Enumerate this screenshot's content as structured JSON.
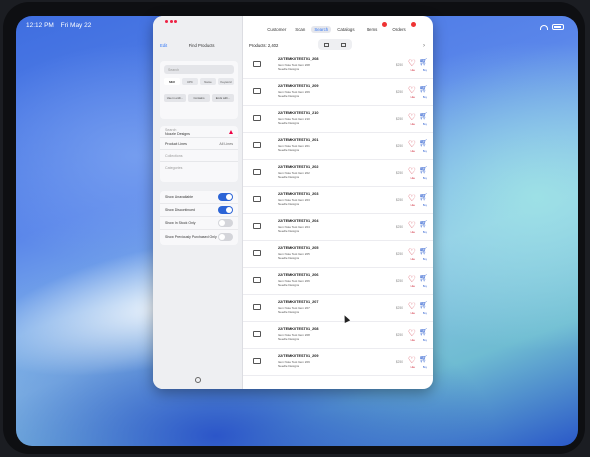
{
  "status_bar": {
    "time": "12:12 PM",
    "date": "Fri May 22"
  },
  "sidebar": {
    "edit_label": "Edit",
    "title": "Find Products",
    "search_placeholder": "Search",
    "segments": [
      "SKU",
      "UPC",
      "Name",
      "Keyword"
    ],
    "chips": [
      "Use in enth...",
      "Contains",
      "Ends with..."
    ],
    "filters": [
      {
        "label": "Search",
        "value": "Nozzle Designs"
      },
      {
        "label": "Product Lines",
        "value": "All Lines"
      },
      {
        "label": "Collections",
        "value": ""
      },
      {
        "label": "Categories",
        "value": ""
      }
    ],
    "toggles": [
      {
        "label": "Show Unavailable",
        "on": true
      },
      {
        "label": "Show Discontinued",
        "on": true
      },
      {
        "label": "Show In Stock Only",
        "on": false
      },
      {
        "label": "Show Previously Purchased Only",
        "on": false
      }
    ]
  },
  "tabs": [
    {
      "label": "Customer",
      "badge": false
    },
    {
      "label": "Scan",
      "badge": false
    },
    {
      "label": "Search",
      "badge": false,
      "active": true
    },
    {
      "label": "Catalogs",
      "badge": false
    },
    {
      "label": "Items",
      "badge": true
    },
    {
      "label": "Orders",
      "badge": true
    }
  ],
  "toolbar": {
    "products_count": "Products: 2,402"
  },
  "products": [
    {
      "sku": "22/TEMK0TEST01_208",
      "name": "Item Note Test Item 208",
      "brand": "Needle Designs",
      "price": "$250"
    },
    {
      "sku": "22/TEMK0TEST01_209",
      "name": "Item Note Test Item 209",
      "brand": "Needle Designs",
      "price": "$250"
    },
    {
      "sku": "22/TEMK0TEST01_210",
      "name": "Item Note Test Item 210",
      "brand": "Needle Designs",
      "price": "$250"
    },
    {
      "sku": "22/TEMK0TEST01_201",
      "name": "Item Note Test Item 201",
      "brand": "Needle Designs",
      "price": "$250"
    },
    {
      "sku": "22/TEMK0TEST01_202",
      "name": "Item Note Test Item 202",
      "brand": "Needle Designs",
      "price": "$250"
    },
    {
      "sku": "22/TEMK0TEST01_203",
      "name": "Item Note Test Item 203",
      "brand": "Needle Designs",
      "price": "$250"
    },
    {
      "sku": "22/TEMK0TEST01_204",
      "name": "Item Note Test Item 204",
      "brand": "Needle Designs",
      "price": "$250"
    },
    {
      "sku": "22/TEMK0TEST01_205",
      "name": "Item Note Test Item 205",
      "brand": "Needle Designs",
      "price": "$250"
    },
    {
      "sku": "22/TEMK0TEST01_206",
      "name": "Item Note Test Item 206",
      "brand": "Needle Designs",
      "price": "$250"
    },
    {
      "sku": "22/TEMK0TEST01_207",
      "name": "Item Note Test Item 207",
      "brand": "Needle Designs",
      "price": "$250"
    },
    {
      "sku": "22/TEMK0TEST01_208",
      "name": "Item Note Test Item 208",
      "brand": "Needle Designs",
      "price": "$250"
    },
    {
      "sku": "22/TEMK0TEST01_209",
      "name": "Item Note Test Item 209",
      "brand": "Needle Designs",
      "price": "$250"
    }
  ],
  "row_actions": {
    "like": "Like",
    "buy": "Buy"
  },
  "icons": {
    "wish": "heart-icon",
    "cart": "cart-icon",
    "image": "image-placeholder-icon",
    "settings": "gear-icon"
  }
}
